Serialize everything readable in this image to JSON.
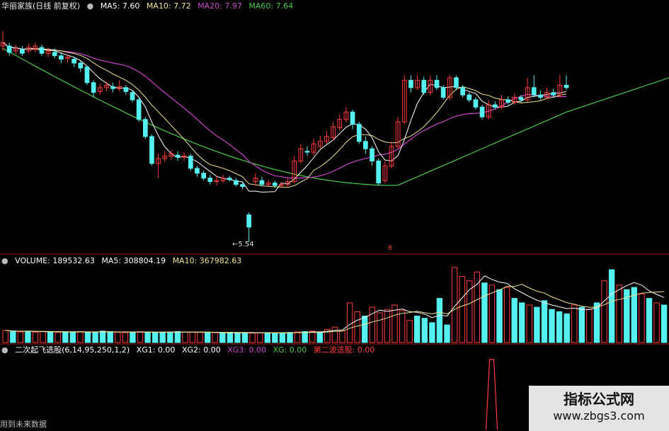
{
  "price_header": {
    "stock": "华丽家族",
    "period": "(日线 前复权)",
    "ma5": "MA5: 7.60",
    "ma10": "MA10: 7.72",
    "ma20": "MA20: 7.97",
    "ma60": "MA60: 7.64",
    "low_label": "5.54",
    "marker": "8"
  },
  "volume_header": {
    "volume": "VOLUME: 189532.63",
    "ma5": "MA5: 308804.19",
    "ma10": "MA10: 367982.63"
  },
  "indicator_header": {
    "name": "二次起飞选股(6,14,95,250,1,2)",
    "xg1": "XG1: 0.00",
    "xg2": "XG2: 0.00",
    "xg3": "XG3: 0.00",
    "xg": "XG: 0.00",
    "second_wave": "第二波选股: 0.00"
  },
  "footnote": "用到未来数据",
  "watermark": {
    "line1": "指标公式网",
    "line2": "www.zbgs3.com"
  },
  "colors": {
    "up": "#ff3c3c",
    "down": "#55f0f0",
    "ma5": "#ffffff",
    "ma10": "#f0e68c",
    "ma20": "#cc44cc",
    "ma60": "#44cc44",
    "separator": "#a01010",
    "signal": "#ff3c3c"
  },
  "chart_data": {
    "type": "candlestick",
    "price_range": [
      5.4,
      10.2
    ],
    "candles": [
      {
        "o": 9.55,
        "c": 9.62,
        "h": 9.85,
        "l": 9.45
      },
      {
        "o": 9.55,
        "c": 9.42,
        "h": 9.62,
        "l": 9.35
      },
      {
        "o": 9.45,
        "c": 9.5,
        "h": 9.58,
        "l": 9.38
      },
      {
        "o": 9.48,
        "c": 9.4,
        "h": 9.55,
        "l": 9.35
      },
      {
        "o": 9.45,
        "c": 9.52,
        "h": 9.6,
        "l": 9.4
      },
      {
        "o": 9.48,
        "c": 9.55,
        "h": 9.62,
        "l": 9.42
      },
      {
        "o": 9.52,
        "c": 9.4,
        "h": 9.58,
        "l": 9.35
      },
      {
        "o": 9.4,
        "c": 9.45,
        "h": 9.52,
        "l": 9.32
      },
      {
        "o": 9.42,
        "c": 9.35,
        "h": 9.5,
        "l": 9.3
      },
      {
        "o": 9.35,
        "c": 9.28,
        "h": 9.4,
        "l": 9.2
      },
      {
        "o": 9.3,
        "c": 9.32,
        "h": 9.38,
        "l": 9.22
      },
      {
        "o": 9.28,
        "c": 9.2,
        "h": 9.32,
        "l": 9.12
      },
      {
        "o": 9.2,
        "c": 9.1,
        "h": 9.25,
        "l": 9.02
      },
      {
        "o": 9.12,
        "c": 8.8,
        "h": 9.15,
        "l": 8.75
      },
      {
        "o": 8.8,
        "c": 8.6,
        "h": 8.85,
        "l": 8.5
      },
      {
        "o": 8.62,
        "c": 8.7,
        "h": 8.78,
        "l": 8.55
      },
      {
        "o": 8.7,
        "c": 8.75,
        "h": 8.82,
        "l": 8.62
      },
      {
        "o": 8.72,
        "c": 8.68,
        "h": 8.8,
        "l": 8.6
      },
      {
        "o": 8.68,
        "c": 8.72,
        "h": 8.85,
        "l": 8.62
      },
      {
        "o": 8.7,
        "c": 8.62,
        "h": 8.75,
        "l": 8.55
      },
      {
        "o": 8.6,
        "c": 8.45,
        "h": 8.65,
        "l": 8.4
      },
      {
        "o": 8.45,
        "c": 8.05,
        "h": 8.5,
        "l": 8.0
      },
      {
        "o": 8.05,
        "c": 7.7,
        "h": 8.1,
        "l": 7.65
      },
      {
        "o": 7.7,
        "c": 7.15,
        "h": 7.75,
        "l": 7.1
      },
      {
        "o": 7.15,
        "c": 7.25,
        "h": 7.35,
        "l": 6.85
      },
      {
        "o": 7.25,
        "c": 7.3,
        "h": 7.4,
        "l": 7.18
      },
      {
        "o": 7.3,
        "c": 7.35,
        "h": 7.42,
        "l": 7.22
      },
      {
        "o": 7.32,
        "c": 7.28,
        "h": 7.4,
        "l": 7.2
      },
      {
        "o": 7.28,
        "c": 7.3,
        "h": 7.38,
        "l": 7.2
      },
      {
        "o": 7.3,
        "c": 7.05,
        "h": 7.35,
        "l": 7.0
      },
      {
        "o": 7.05,
        "c": 6.95,
        "h": 7.1,
        "l": 6.88
      },
      {
        "o": 6.95,
        "c": 6.85,
        "h": 7.0,
        "l": 6.8
      },
      {
        "o": 6.85,
        "c": 6.78,
        "h": 6.92,
        "l": 6.72
      },
      {
        "o": 6.78,
        "c": 6.8,
        "h": 6.9,
        "l": 6.7
      },
      {
        "o": 6.8,
        "c": 6.85,
        "h": 6.92,
        "l": 6.75
      },
      {
        "o": 6.85,
        "c": 6.82,
        "h": 6.9,
        "l": 6.78
      },
      {
        "o": 6.8,
        "c": 6.72,
        "h": 6.85,
        "l": 6.68
      },
      {
        "o": 6.72,
        "c": 6.68,
        "h": 6.78,
        "l": 6.62
      },
      {
        "o": 6.1,
        "c": 5.85,
        "h": 6.15,
        "l": 5.54
      },
      {
        "o": 6.78,
        "c": 6.85,
        "h": 6.95,
        "l": 6.7
      },
      {
        "o": 6.8,
        "c": 6.72,
        "h": 6.88,
        "l": 6.68
      },
      {
        "o": 6.72,
        "c": 6.75,
        "h": 6.82,
        "l": 6.68
      },
      {
        "o": 6.75,
        "c": 6.7,
        "h": 6.8,
        "l": 6.65
      },
      {
        "o": 6.7,
        "c": 6.72,
        "h": 6.78,
        "l": 6.66
      },
      {
        "o": 6.72,
        "c": 6.78,
        "h": 6.85,
        "l": 6.68
      },
      {
        "o": 6.78,
        "c": 7.2,
        "h": 7.3,
        "l": 6.75
      },
      {
        "o": 7.2,
        "c": 7.45,
        "h": 7.55,
        "l": 7.15
      },
      {
        "o": 7.4,
        "c": 7.38,
        "h": 7.5,
        "l": 7.3
      },
      {
        "o": 7.38,
        "c": 7.55,
        "h": 7.65,
        "l": 7.32
      },
      {
        "o": 7.5,
        "c": 7.6,
        "h": 7.72,
        "l": 7.45
      },
      {
        "o": 7.6,
        "c": 7.7,
        "h": 7.8,
        "l": 7.55
      },
      {
        "o": 7.68,
        "c": 7.9,
        "h": 8.0,
        "l": 7.62
      },
      {
        "o": 7.88,
        "c": 8.05,
        "h": 8.15,
        "l": 7.82
      },
      {
        "o": 8.05,
        "c": 8.2,
        "h": 8.3,
        "l": 7.98
      },
      {
        "o": 8.2,
        "c": 7.95,
        "h": 8.25,
        "l": 7.85
      },
      {
        "o": 7.95,
        "c": 7.6,
        "h": 8.0,
        "l": 7.55
      },
      {
        "o": 7.6,
        "c": 7.45,
        "h": 7.7,
        "l": 7.35
      },
      {
        "o": 7.45,
        "c": 7.2,
        "h": 7.5,
        "l": 7.1
      },
      {
        "o": 7.2,
        "c": 6.75,
        "h": 7.25,
        "l": 6.7
      },
      {
        "o": 6.8,
        "c": 7.1,
        "h": 7.2,
        "l": 6.75
      },
      {
        "o": 7.1,
        "c": 7.5,
        "h": 7.6,
        "l": 7.05
      },
      {
        "o": 7.5,
        "c": 8.0,
        "h": 8.1,
        "l": 7.45
      },
      {
        "o": 8.0,
        "c": 8.85,
        "h": 8.95,
        "l": 7.95
      },
      {
        "o": 8.85,
        "c": 8.7,
        "h": 8.95,
        "l": 8.6
      },
      {
        "o": 8.7,
        "c": 8.85,
        "h": 8.95,
        "l": 8.65
      },
      {
        "o": 8.85,
        "c": 8.6,
        "h": 8.92,
        "l": 8.55
      },
      {
        "o": 8.6,
        "c": 8.85,
        "h": 8.95,
        "l": 8.55
      },
      {
        "o": 8.85,
        "c": 8.7,
        "h": 8.95,
        "l": 8.65
      },
      {
        "o": 8.7,
        "c": 8.5,
        "h": 8.75,
        "l": 8.45
      },
      {
        "o": 8.5,
        "c": 8.9,
        "h": 8.95,
        "l": 8.45
      },
      {
        "o": 8.9,
        "c": 8.7,
        "h": 8.95,
        "l": 8.65
      },
      {
        "o": 8.7,
        "c": 8.55,
        "h": 8.75,
        "l": 8.5
      },
      {
        "o": 8.55,
        "c": 8.45,
        "h": 8.6,
        "l": 8.4
      },
      {
        "o": 8.45,
        "c": 8.3,
        "h": 8.5,
        "l": 8.25
      },
      {
        "o": 8.3,
        "c": 8.1,
        "h": 8.35,
        "l": 8.05
      },
      {
        "o": 8.1,
        "c": 8.35,
        "h": 8.45,
        "l": 8.05
      },
      {
        "o": 8.35,
        "c": 8.3,
        "h": 8.42,
        "l": 8.25
      },
      {
        "o": 8.3,
        "c": 8.45,
        "h": 8.55,
        "l": 8.25
      },
      {
        "o": 8.45,
        "c": 8.4,
        "h": 8.52,
        "l": 8.35
      },
      {
        "o": 8.4,
        "c": 8.5,
        "h": 8.58,
        "l": 8.35
      },
      {
        "o": 8.5,
        "c": 8.45,
        "h": 8.55,
        "l": 8.4
      },
      {
        "o": 8.45,
        "c": 8.7,
        "h": 8.9,
        "l": 8.4
      },
      {
        "o": 8.7,
        "c": 8.55,
        "h": 8.95,
        "l": 8.5
      },
      {
        "o": 8.55,
        "c": 8.5,
        "h": 8.65,
        "l": 8.45
      },
      {
        "o": 8.5,
        "c": 8.6,
        "h": 8.7,
        "l": 8.45
      },
      {
        "o": 8.6,
        "c": 8.55,
        "h": 8.68,
        "l": 8.5
      },
      {
        "o": 8.55,
        "c": 8.75,
        "h": 8.95,
        "l": 8.5
      },
      {
        "o": 8.75,
        "c": 8.7,
        "h": 8.95,
        "l": 8.65
      }
    ],
    "volume": [
      55,
      50,
      48,
      52,
      47,
      50,
      49,
      46,
      48,
      47,
      50,
      46,
      48,
      52,
      49,
      46,
      45,
      47,
      49,
      48,
      46,
      45,
      47,
      50,
      48,
      47,
      46,
      44,
      45,
      43,
      46,
      44,
      45,
      43,
      44,
      45,
      43,
      44,
      46,
      48,
      50,
      52,
      45,
      60,
      70,
      55,
      180,
      140,
      120,
      160,
      135,
      150,
      170,
      145,
      100,
      120,
      110,
      90,
      200,
      80,
      340,
      300,
      280,
      320,
      270,
      260,
      240,
      250,
      200,
      180,
      170,
      160,
      190,
      150,
      140,
      130,
      170,
      160,
      150,
      180,
      280,
      330,
      260,
      240,
      250,
      220,
      200,
      180,
      170
    ],
    "ma60_range": [
      6.7,
      9.5
    ],
    "low_price": 5.54,
    "signal_position": 0.735
  }
}
